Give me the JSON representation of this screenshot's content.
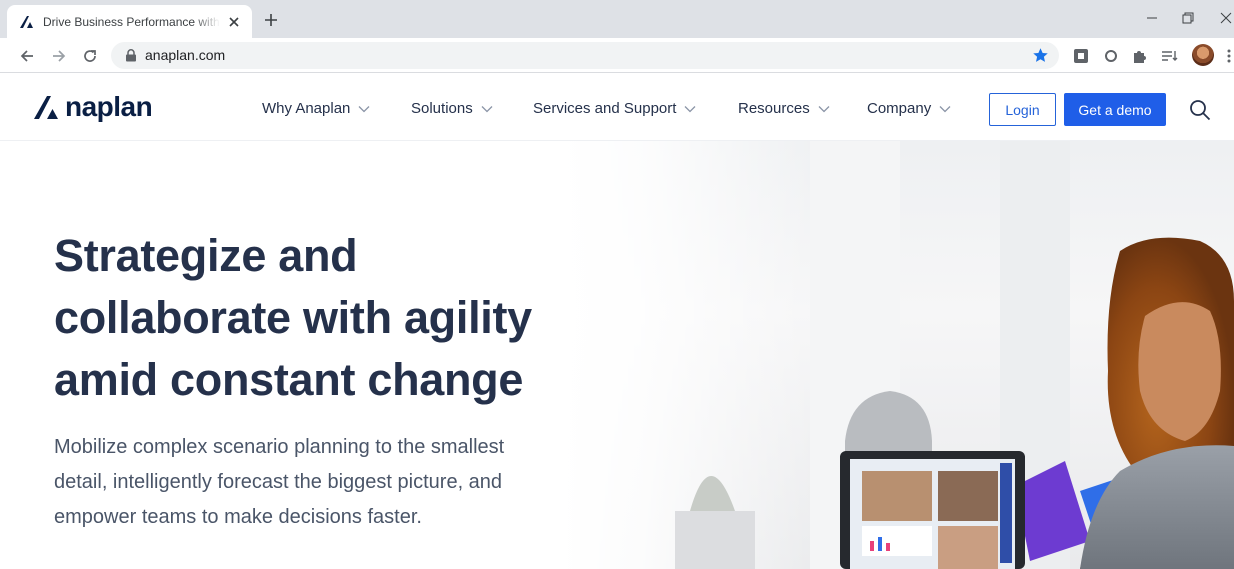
{
  "browser": {
    "tab_title": "Drive Business Performance with",
    "url": "anaplan.com"
  },
  "site": {
    "logo_text": "naplan",
    "nav": [
      {
        "label": "Why Anaplan"
      },
      {
        "label": "Solutions"
      },
      {
        "label": "Services and Support"
      },
      {
        "label": "Resources"
      },
      {
        "label": "Company"
      }
    ],
    "login_label": "Login",
    "demo_label": "Get a demo"
  },
  "hero": {
    "title_lines": [
      "Strategize and",
      "collaborate with agility",
      "amid constant change"
    ],
    "subtitle": "Mobilize complex scenario planning to the smallest detail, intelligently forecast the biggest picture, and empower teams to make decisions faster."
  },
  "colors": {
    "brand_navy": "#0a1f44",
    "accent_blue": "#1f5ee8",
    "heading": "#25314b"
  },
  "icons": {
    "favicon": "anaplan-a-icon",
    "search": "search-icon",
    "back": "back-arrow-icon",
    "forward": "forward-arrow-icon",
    "reload": "reload-icon",
    "bookmark": "star-icon"
  }
}
